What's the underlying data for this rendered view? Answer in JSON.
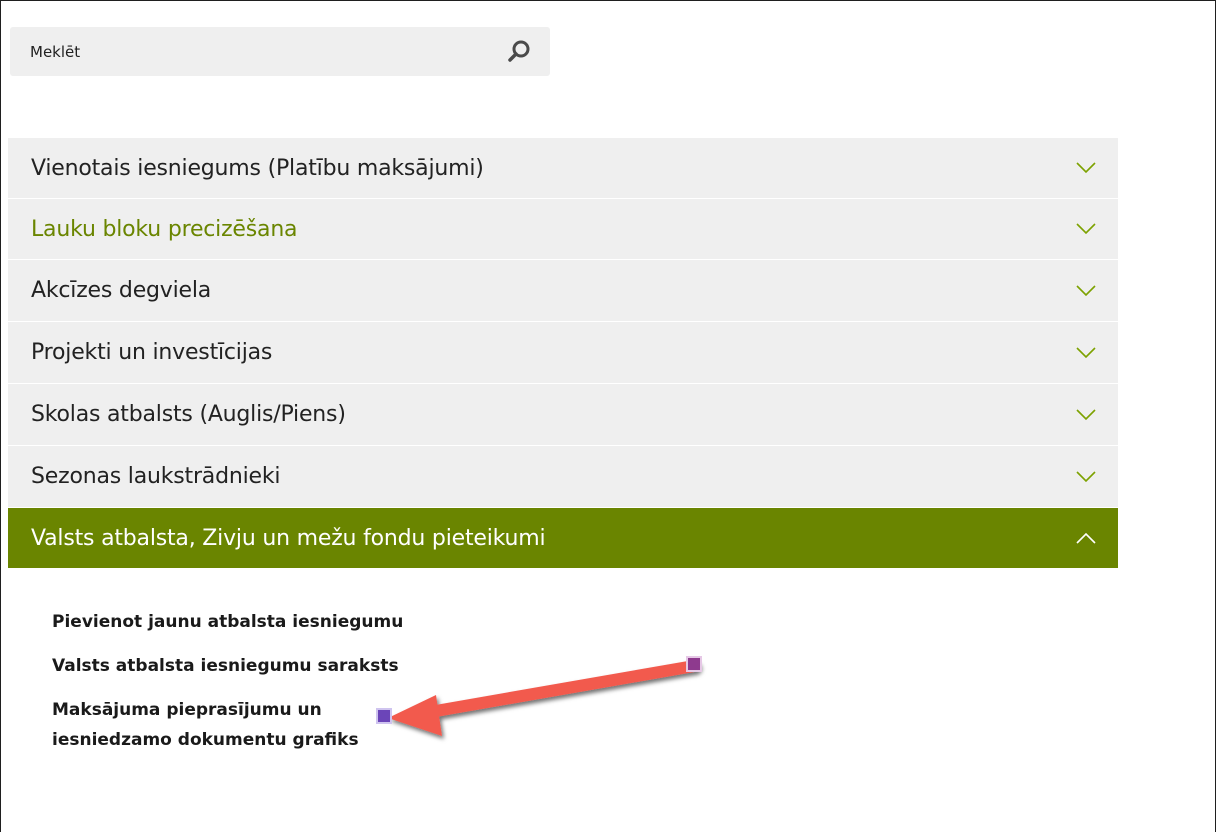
{
  "search": {
    "placeholder": "Meklēt",
    "icon": "search-icon"
  },
  "accordion": {
    "items": [
      {
        "label": "Vienotais iesniegums (Platību maksājumi)",
        "state": "collapsed"
      },
      {
        "label": "Lauku bloku precizēšana",
        "state": "collapsed"
      },
      {
        "label": "Akcīzes degviela",
        "state": "collapsed"
      },
      {
        "label": "Projekti un investīcijas",
        "state": "collapsed"
      },
      {
        "label": "Skolas atbalsts (Auglis/Piens)",
        "state": "collapsed"
      },
      {
        "label": "Sezonas laukstrādnieki",
        "state": "collapsed"
      },
      {
        "label": "Valsts atbalsta, Zivju un mežu fondu pieteikumi",
        "state": "expanded"
      }
    ],
    "sub_items": [
      "Pievienot jaunu atbalsta iesniegumu",
      "Valsts atbalsta iesniegumu saraksts",
      "Maksājuma pieprasījumu un iesniedzamo dokumentu grafiks"
    ]
  },
  "colors": {
    "accent": "#6a8500",
    "panel": "#efefef",
    "text": "#222222",
    "annotation_arrow": "#f25a4e",
    "annotation_handle": "#8e3a8e"
  }
}
